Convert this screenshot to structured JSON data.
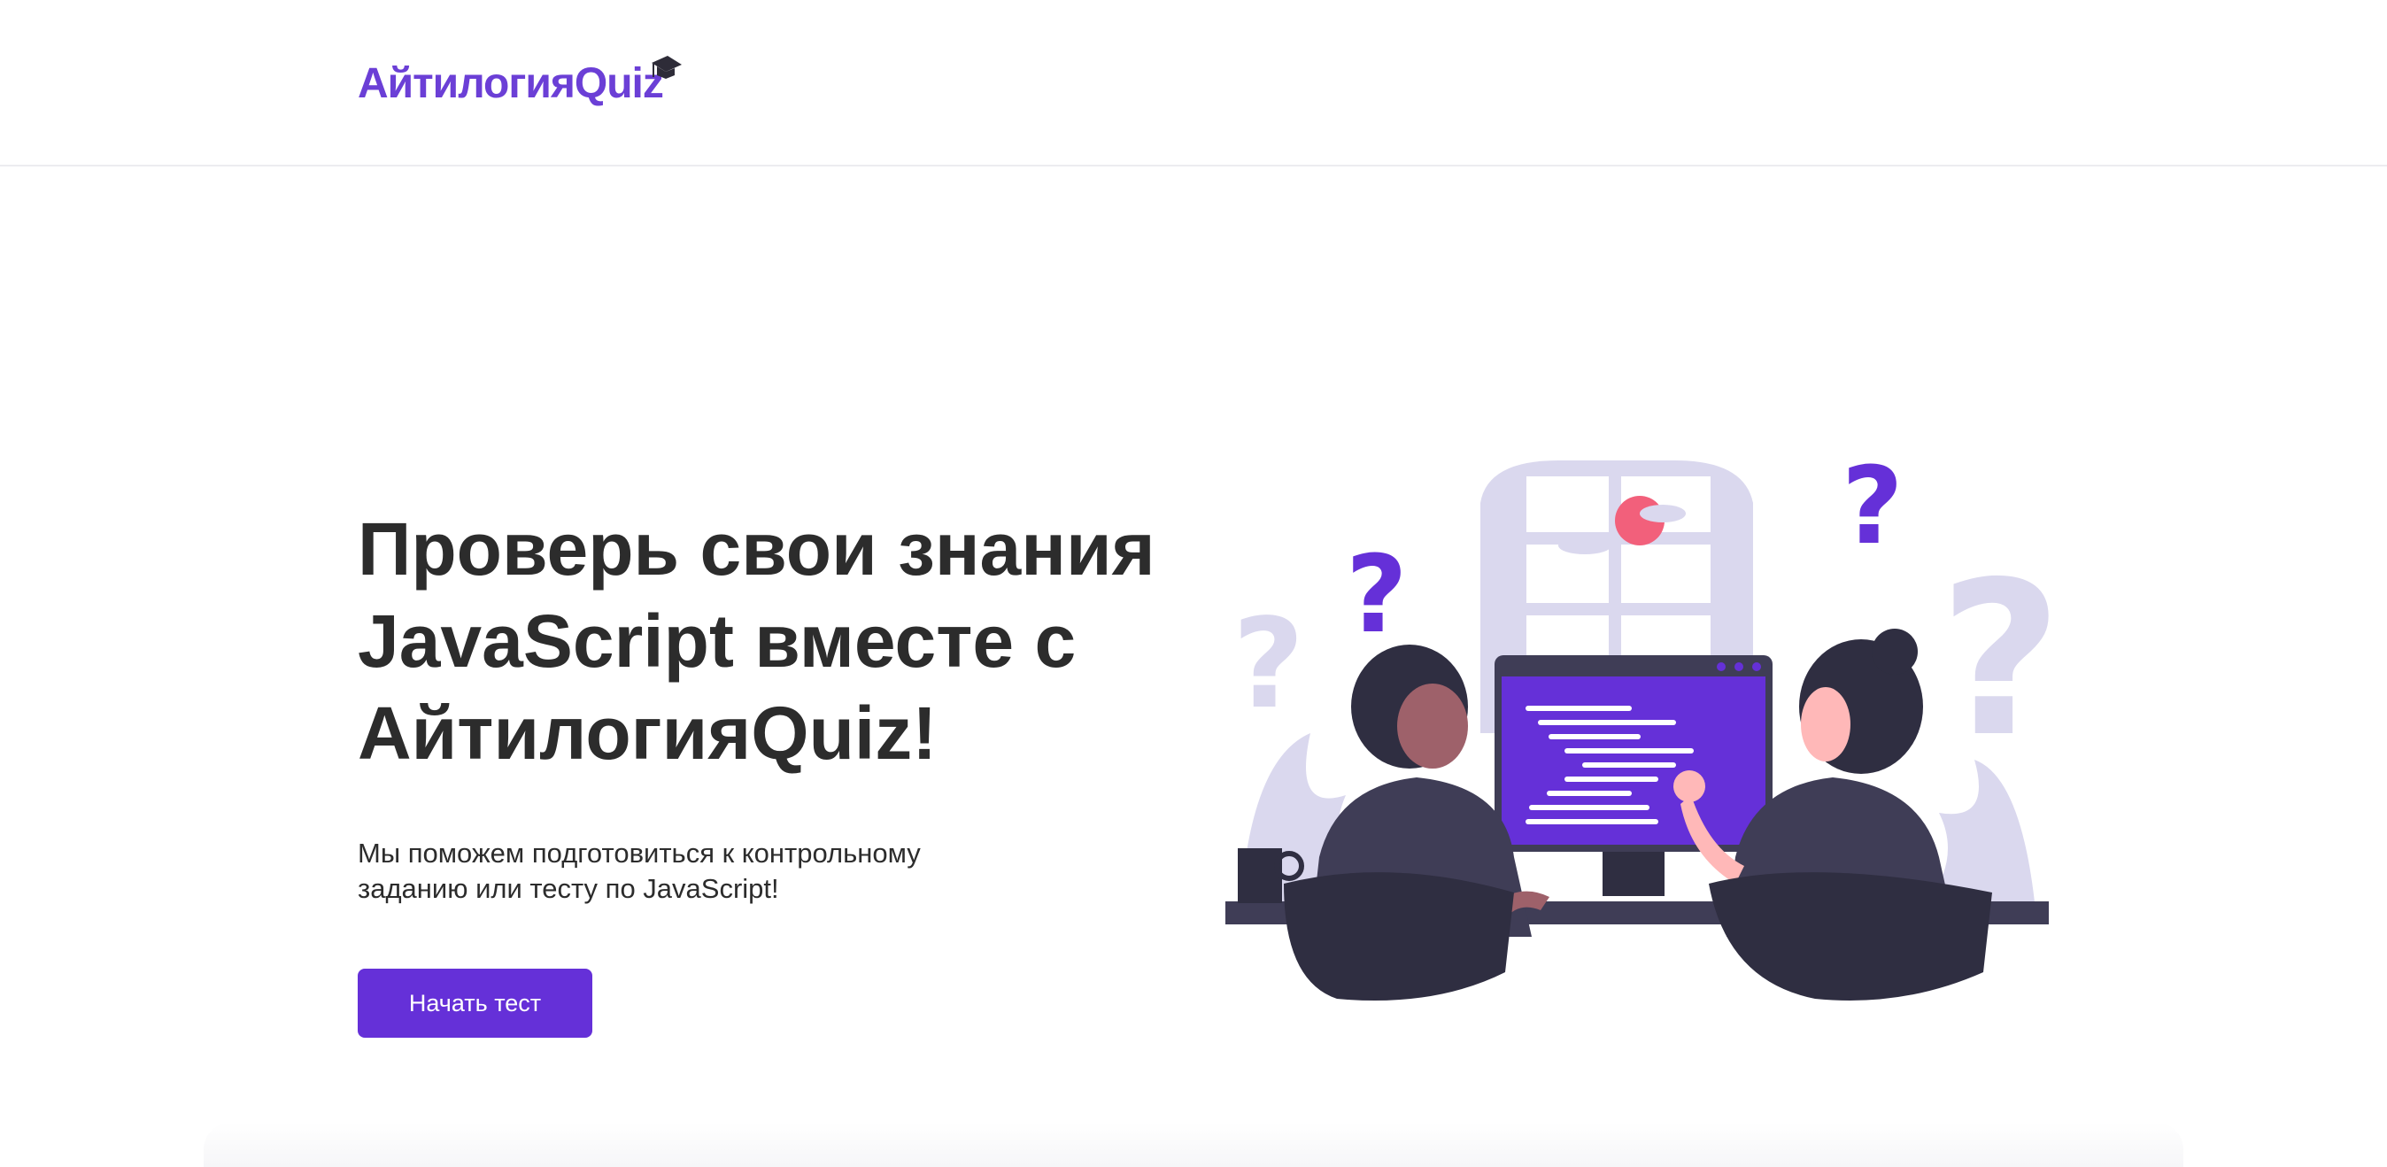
{
  "brand": {
    "logo_text": "АйтилогияQuiz",
    "accent_color": "#6530d8",
    "logo_color": "#6b3fd6"
  },
  "hero": {
    "title_lines": [
      "Проверь свои знания",
      "JavaScript вместе с",
      "АйтилогияQuiz!"
    ],
    "subtitle_lines": [
      "Мы поможем подготовиться к контрольному",
      "заданию или тесту по JavaScript!"
    ],
    "cta_label": "Начать тест"
  },
  "illustration": {
    "subject": "two developers at a computer with question marks",
    "icons": [
      "graduation-cap-icon",
      "question-mark-icon",
      "monitor-icon",
      "coffee-mug-icon"
    ]
  }
}
